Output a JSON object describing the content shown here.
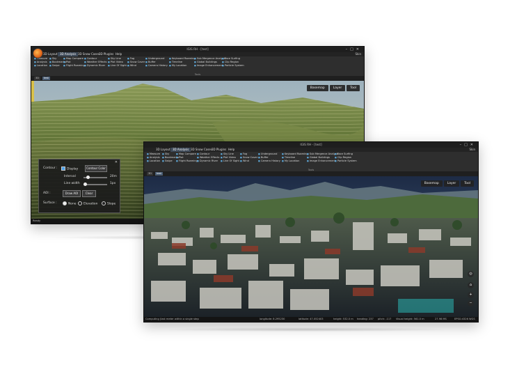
{
  "app": {
    "window_title": "IGIS RH - [test]",
    "menu_tabs": [
      "3D Layout",
      "3D Analysis",
      "3D Snow Cases",
      "3D Plugins",
      "Help"
    ],
    "active_tab": "3D Analysis",
    "user": "Skin",
    "ribbon_caption": "Tools",
    "ribbon_items": {
      "col1": [
        "Measure",
        "Analysis",
        "Location"
      ],
      "col2": [
        "Sky",
        "Bookmarks",
        "Swipe"
      ],
      "col3": [
        "Map Compare",
        "Plot",
        "Flight Roaming"
      ],
      "col4": [
        "Contour",
        "Weather Effects",
        "Dynamic River"
      ],
      "col5": [
        "Sky Line",
        "Plot Video",
        "Line Of Sight"
      ],
      "col6": [
        "Fog",
        "Snow Cover",
        "Wind"
      ],
      "col7": [
        "Underground",
        "Buffer",
        "Camera History"
      ],
      "col8": [
        "Keyboard Roaming",
        "Timeline",
        "My Location"
      ],
      "col9": [
        "Sub Mergence Analysis",
        "Global Buildings",
        "Image Enhancement"
      ],
      "col10": [
        "Face Surfing",
        "Clip Region",
        "Particle System"
      ]
    },
    "doc_tabs": [
      "3D",
      "test"
    ],
    "toolbar": {
      "basemap": "Basemap",
      "layer": "Layer",
      "tool": "Tool"
    }
  },
  "back_window": {
    "status": "Ready",
    "contour_panel": {
      "contour_label": "Contour :",
      "display_label": "Display",
      "contour_color_button": "Contour Color",
      "interval_label": "Interval",
      "interval_value": "20m",
      "linewidth_label": "Line width",
      "linewidth_value": "1px",
      "aoi_label": "AOI :",
      "draw_aoi_button": "Draw AOI",
      "clear_button": "Clear",
      "surface_label": "Surface :",
      "surface_options": [
        "None",
        "Elevation",
        "Slope"
      ]
    }
  },
  "front_window": {
    "status": {
      "hint": "Computing (last meter within a single step",
      "longitude": "longitude: 8.295230",
      "latitude": "latitude: 47.052403",
      "height": "height: 532.0 m",
      "heading": "heading: 237",
      "pitch": "pitch: -117",
      "visual_height": "Visual height: 561.0 m",
      "fps": "27.98 MS",
      "crs": "EPSG:4326 WGS"
    }
  },
  "colors": {
    "accent": "#3e4a59",
    "ribbon_icon": "#5fa8d8",
    "panel_bg": "#1c1c1c"
  }
}
